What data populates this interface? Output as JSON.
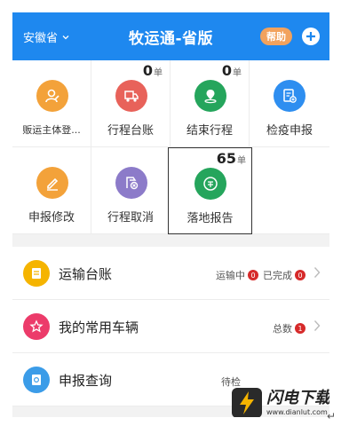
{
  "header": {
    "province": "安徽省",
    "title": "牧运通-省版",
    "help_label": "帮助"
  },
  "grid": {
    "items": [
      {
        "label": "贩运主体登...",
        "icon": "person-edit-icon",
        "color": "#f3a23a"
      },
      {
        "label": "行程台账",
        "icon": "truck-icon",
        "color": "#e8625a",
        "count": "0",
        "unit": "单"
      },
      {
        "label": "结束行程",
        "icon": "location-pin-icon",
        "color": "#25a55c",
        "count": "0",
        "unit": "单"
      },
      {
        "label": "检疫申报",
        "icon": "add-document-icon",
        "color": "#2e8ef0"
      },
      {
        "label": "申报修改",
        "icon": "edit-pencil-icon",
        "color": "#f3a23a"
      },
      {
        "label": "行程取消",
        "icon": "cancel-route-icon",
        "color": "#8c7bc9"
      },
      {
        "label": "落地报告",
        "icon": "landing-report-icon",
        "color": "#25a55c",
        "count": "65",
        "unit": "单"
      }
    ]
  },
  "list": {
    "rows": [
      {
        "title": "运输台账",
        "icon": "ledger-icon",
        "color": "#f5b400",
        "status": [
          {
            "text": "运输中",
            "badge": "0"
          },
          {
            "text": "已完成",
            "badge": "0"
          }
        ]
      },
      {
        "title": "我的常用车辆",
        "icon": "star-icon",
        "color": "#ec3b6a",
        "status": [
          {
            "text": "总数",
            "badge": "1"
          }
        ]
      },
      {
        "title": "申报查询",
        "icon": "query-icon",
        "color": "#3b9ce8",
        "status_text": "待检"
      }
    ]
  },
  "watermark": {
    "brand": "闪电下载",
    "url": "www.dianlut.com"
  },
  "corner_mark": "↵"
}
